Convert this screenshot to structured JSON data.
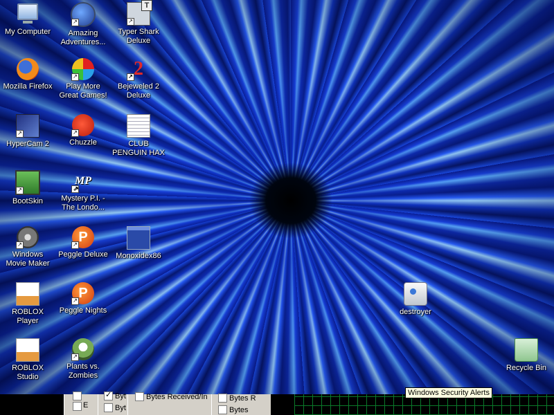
{
  "desktop": {
    "icons": [
      {
        "label": "My Computer",
        "icon": "computer-icon"
      },
      {
        "label": "Amazing Adventures...",
        "icon": "globe-icon"
      },
      {
        "label": "Typer Shark Deluxe",
        "icon": "typer-shark-icon"
      },
      {
        "label": "Mozilla Firefox",
        "icon": "firefox-icon"
      },
      {
        "label": "Play More Great Games!",
        "icon": "play-more-icon"
      },
      {
        "label": "Bejeweled 2 Deluxe",
        "icon": "bejeweled-icon"
      },
      {
        "label": "HyperCam 2",
        "icon": "hypercam-icon"
      },
      {
        "label": "Chuzzle",
        "icon": "chuzzle-icon"
      },
      {
        "label": "CLUB PENGUIN HAX",
        "icon": "text-document-icon"
      },
      {
        "label": "BootSkin",
        "icon": "bootskin-icon"
      },
      {
        "label": "Mystery P.I. - The Londo...",
        "icon": "mystery-pi-icon"
      },
      {
        "label": "Windows Movie Maker",
        "icon": "movie-maker-icon"
      },
      {
        "label": "Peggle Deluxe",
        "icon": "peggle-icon"
      },
      {
        "label": "Monoxidex86",
        "icon": "window-app-icon"
      },
      {
        "label": "ROBLOX Player",
        "icon": "roblox-icon"
      },
      {
        "label": "Peggle Nights",
        "icon": "peggle-nights-icon"
      },
      {
        "label": "destroyer",
        "icon": "destroyer-icon"
      },
      {
        "label": "ROBLOX Studio",
        "icon": "roblox-studio-icon"
      },
      {
        "label": "Plants vs. Zombies",
        "icon": "plants-vs-zombies-icon"
      },
      {
        "label": "Recycle Bin",
        "icon": "recycle-bin-icon"
      }
    ]
  },
  "bottom_panels": {
    "col1": [
      "",
      "E"
    ],
    "col2": [
      "Byt",
      "Byt"
    ],
    "col3": "Bytes Received/In",
    "col4": [
      "Bytes R",
      "Bytes"
    ]
  },
  "tooltip": "Windows Security Alerts"
}
